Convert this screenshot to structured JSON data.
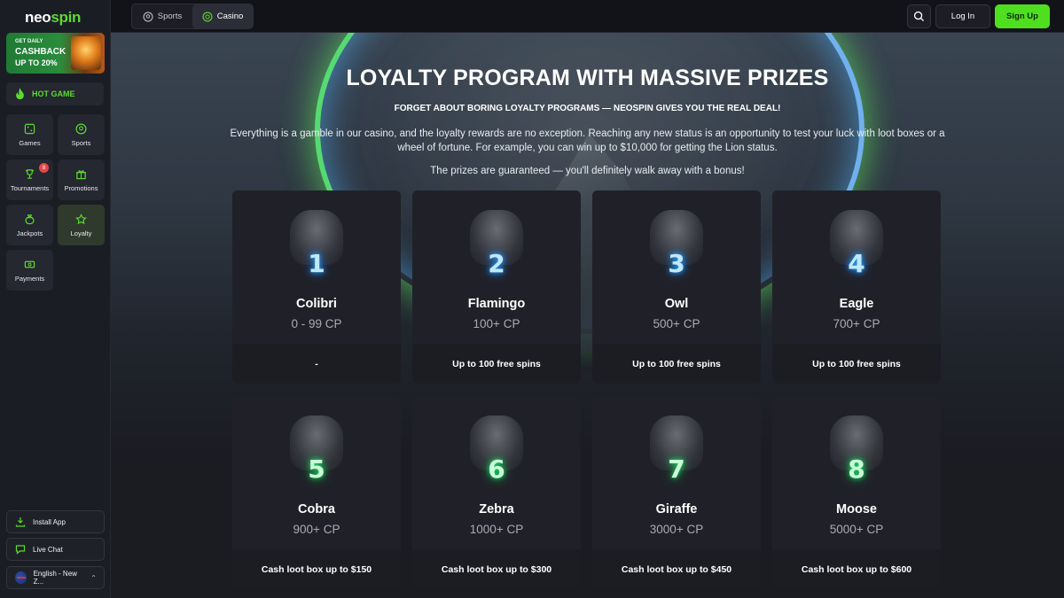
{
  "brand": {
    "neo": "neo",
    "spin": "spin"
  },
  "promo": {
    "line1": "GET DAILY",
    "line2": "CASHBACK",
    "line3": "UP TO 20%"
  },
  "hot_game": {
    "label": "HOT GAME"
  },
  "nav": [
    {
      "label": "Games",
      "icon": "dice-icon"
    },
    {
      "label": "Sports",
      "icon": "soccer-ball-icon"
    },
    {
      "label": "Tournaments",
      "icon": "trophy-icon",
      "badge": "8"
    },
    {
      "label": "Promotions",
      "icon": "gift-icon"
    },
    {
      "label": "Jackpots",
      "icon": "money-bag-icon"
    },
    {
      "label": "Loyalty",
      "icon": "star-icon",
      "active": true
    },
    {
      "label": "Payments",
      "icon": "cash-icon"
    }
  ],
  "sidebar_bottom": {
    "install": "Install App",
    "chat": "Live Chat",
    "language": "English - New Z..."
  },
  "topbar": {
    "sports": "Sports",
    "casino": "Casino",
    "login": "Log In",
    "signup": "Sign Up"
  },
  "hero": {
    "title": "LOYALTY PROGRAM WITH MASSIVE PRIZES",
    "subtitle": "FORGET ABOUT BORING LOYALTY PROGRAMS — NEOSPIN GIVES YOU THE REAL DEAL!",
    "description": "Everything is a gamble in our casino, and the loyalty rewards are no exception. Reaching any new status is an opportunity to test your luck with loot boxes or a wheel of fortune. For example, you can win up to $10,000 for getting the Lion status.",
    "guarantee": "The prizes are guaranteed — you'll definitely walk away with a bonus!"
  },
  "levels": [
    {
      "num": "1",
      "name": "Colibri",
      "cp": "0 - 99 CP",
      "reward": "-",
      "glow": "blue"
    },
    {
      "num": "2",
      "name": "Flamingo",
      "cp": "100+ CP",
      "reward": "Up to 100 free spins",
      "glow": "blue"
    },
    {
      "num": "3",
      "name": "Owl",
      "cp": "500+ CP",
      "reward": "Up to 100 free spins",
      "glow": "blue"
    },
    {
      "num": "4",
      "name": "Eagle",
      "cp": "700+ CP",
      "reward": "Up to 100 free spins",
      "glow": "blue"
    },
    {
      "num": "5",
      "name": "Cobra",
      "cp": "900+ CP",
      "reward": "Cash loot box up to $150",
      "glow": "green"
    },
    {
      "num": "6",
      "name": "Zebra",
      "cp": "1000+ CP",
      "reward": "Cash loot box up to $300",
      "glow": "green"
    },
    {
      "num": "7",
      "name": "Giraffe",
      "cp": "3000+ CP",
      "reward": "Cash loot box up to $450",
      "glow": "green"
    },
    {
      "num": "8",
      "name": "Moose",
      "cp": "5000+ CP",
      "reward": "Cash loot box up to $600",
      "glow": "green"
    }
  ],
  "colors": {
    "accent": "#4ee01e",
    "sidebar": "#1b1d24",
    "card": "#1c1d23"
  }
}
